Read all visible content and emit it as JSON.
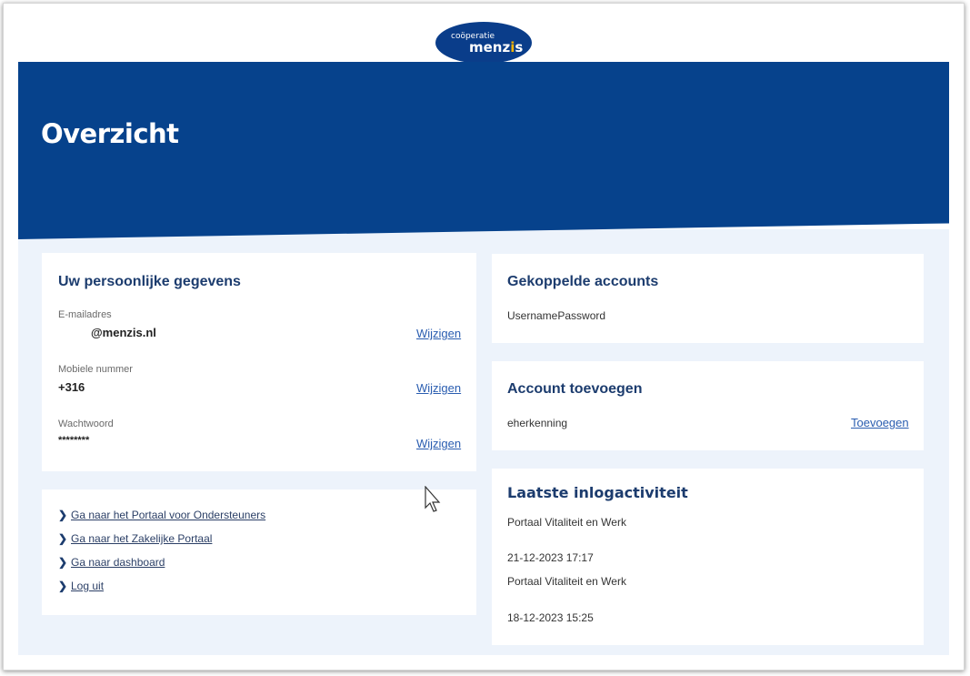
{
  "logo": {
    "line1": "coöperatie",
    "brand_main": "menz",
    "brand_accent": "i",
    "brand_end": "s"
  },
  "hero": {
    "title": "Overzicht"
  },
  "personal": {
    "title": "Uw persoonlijke gegevens",
    "email": {
      "label": "E-mailadres",
      "value": "@menzis.nl",
      "edit": "Wijzigen"
    },
    "mobile": {
      "label": "Mobiele nummer",
      "value": "+316",
      "edit": "Wijzigen"
    },
    "password": {
      "label": "Wachtwoord",
      "value": "********",
      "edit": "Wijzigen"
    }
  },
  "links": [
    {
      "label": "Ga naar het Portaal voor Ondersteuners"
    },
    {
      "label": "Ga naar het Zakelijke Portaal"
    },
    {
      "label": "Ga naar dashboard"
    },
    {
      "label": "Log uit"
    }
  ],
  "linked_accounts": {
    "title": "Gekoppelde accounts",
    "value": "UsernamePassword"
  },
  "add_account": {
    "title": "Account toevoegen",
    "provider": "eherkenning",
    "action": "Toevoegen"
  },
  "activity": {
    "title": "Laatste inlogactiviteit",
    "entries": [
      {
        "portal": "Portaal Vitaliteit en Werk",
        "datetime": "21-12-2023 17:17"
      },
      {
        "portal": "Portaal Vitaliteit en Werk",
        "datetime": "18-12-2023 15:25"
      }
    ]
  },
  "colors": {
    "primary": "#06428c",
    "accent": "#f6b400",
    "background": "#edf3fb"
  }
}
